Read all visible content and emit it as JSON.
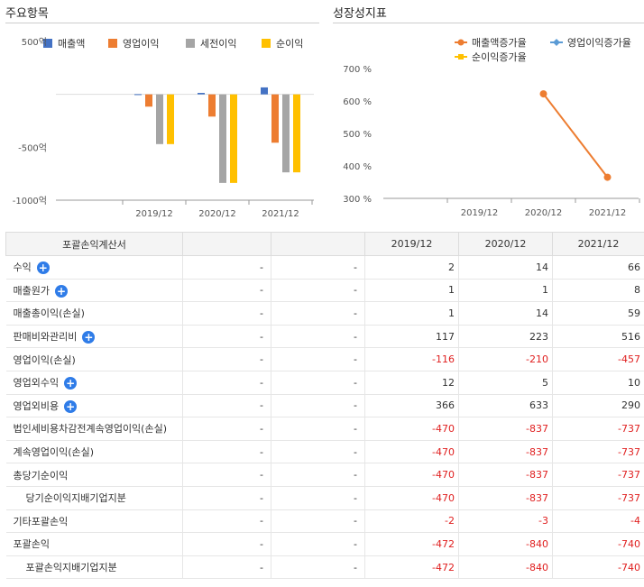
{
  "left_panel": {
    "title": "주요항목"
  },
  "right_panel": {
    "title": "성장성지표"
  },
  "chart_data": [
    {
      "type": "bar",
      "categories": [
        "2019/12",
        "2020/12",
        "2021/12"
      ],
      "series": [
        {
          "name": "매출액",
          "values": [
            2,
            14,
            66
          ],
          "color": "#4472c4"
        },
        {
          "name": "영업이익",
          "values": [
            -116,
            -210,
            -457
          ],
          "color": "#ed7d31"
        },
        {
          "name": "세전이익",
          "values": [
            -470,
            -837,
            -737
          ],
          "color": "#a5a5a5"
        },
        {
          "name": "순이익",
          "values": [
            -470,
            -837,
            -737
          ],
          "color": "#ffc000"
        }
      ],
      "y_ticks": [
        "500억",
        "-500억",
        "-1000억"
      ],
      "ylim": [
        -1000,
        500
      ],
      "legend": "top"
    },
    {
      "type": "line",
      "categories": [
        "2019/12",
        "2020/12",
        "2021/12"
      ],
      "series": [
        {
          "name": "매출액증가율",
          "values": [
            null,
            622,
            365
          ],
          "color": "#ed7d31"
        },
        {
          "name": "영업이익증가율",
          "values": [
            null,
            null,
            null
          ],
          "color": "#5b9bd5"
        },
        {
          "name": "순이익증가율",
          "values": [
            null,
            null,
            null
          ],
          "color": "#ffc000"
        }
      ],
      "y_ticks": [
        "700 %",
        "600 %",
        "500 %",
        "400 %",
        "300 %"
      ],
      "ylim": [
        300,
        700
      ],
      "legend": "top"
    }
  ],
  "table": {
    "header": {
      "label": "포괄손익계산서",
      "years": [
        "2019/12",
        "2020/12",
        "2021/12"
      ]
    },
    "rows": [
      {
        "label": "수익",
        "expand": true,
        "d1": "-",
        "d2": "-",
        "v": [
          "2",
          "14",
          "66"
        ]
      },
      {
        "label": "매출원가",
        "expand": true,
        "d1": "-",
        "d2": "-",
        "v": [
          "1",
          "1",
          "8"
        ]
      },
      {
        "label": "매출총이익(손실)",
        "expand": false,
        "d1": "-",
        "d2": "-",
        "v": [
          "1",
          "14",
          "59"
        ]
      },
      {
        "label": "판매비와관리비",
        "expand": true,
        "d1": "-",
        "d2": "-",
        "v": [
          "117",
          "223",
          "516"
        ]
      },
      {
        "label": "영업이익(손실)",
        "expand": false,
        "d1": "-",
        "d2": "-",
        "v": [
          "-116",
          "-210",
          "-457"
        ]
      },
      {
        "label": "영업외수익",
        "expand": true,
        "d1": "-",
        "d2": "-",
        "v": [
          "12",
          "5",
          "10"
        ]
      },
      {
        "label": "영업외비용",
        "expand": true,
        "d1": "-",
        "d2": "-",
        "v": [
          "366",
          "633",
          "290"
        ]
      },
      {
        "label": "법인세비용차감전계속영업이익(손실)",
        "expand": false,
        "d1": "-",
        "d2": "-",
        "v": [
          "-470",
          "-837",
          "-737"
        ]
      },
      {
        "label": "계속영업이익(손실)",
        "expand": false,
        "d1": "-",
        "d2": "-",
        "v": [
          "-470",
          "-837",
          "-737"
        ]
      },
      {
        "label": "총당기순이익",
        "expand": false,
        "d1": "-",
        "d2": "-",
        "v": [
          "-470",
          "-837",
          "-737"
        ]
      },
      {
        "label": "당기순이익지배기업지분",
        "expand": false,
        "indent": true,
        "d1": "-",
        "d2": "-",
        "v": [
          "-470",
          "-837",
          "-737"
        ]
      },
      {
        "label": "기타포괄손익",
        "expand": false,
        "d1": "-",
        "d2": "-",
        "v": [
          "-2",
          "-3",
          "-4"
        ]
      },
      {
        "label": "포괄손익",
        "expand": false,
        "d1": "-",
        "d2": "-",
        "v": [
          "-472",
          "-840",
          "-740"
        ]
      },
      {
        "label": "포괄손익지배기업지분",
        "expand": false,
        "indent": true,
        "d1": "-",
        "d2": "-",
        "v": [
          "-472",
          "-840",
          "-740"
        ]
      }
    ]
  }
}
